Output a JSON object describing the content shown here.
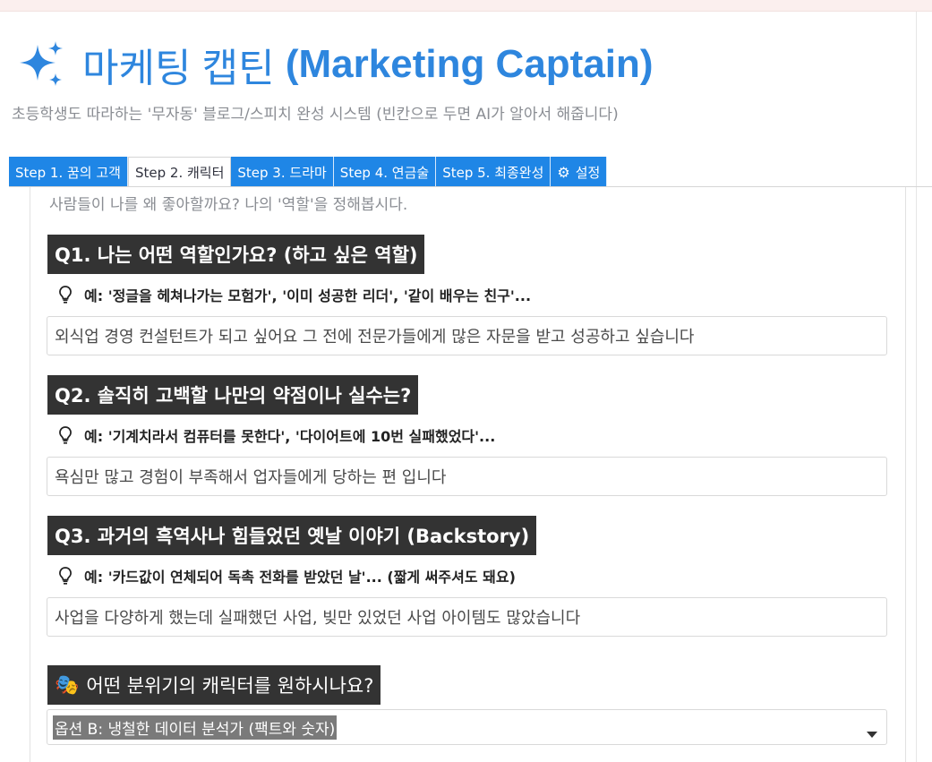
{
  "app": {
    "title_icon": "sparkles-icon",
    "title_korean": "마케팅 캡틴",
    "title_english": "(Marketing Captain)",
    "subtitle": "초등학생도 따라하는 '무자동' 블로그/스피치 완성 시스템 (빈칸으로 두면 AI가 알아서 해줍니다)",
    "accent_color": "#2e86de"
  },
  "tabs": [
    {
      "label": "Step 1. 꿈의 고객",
      "active": false
    },
    {
      "label": "Step 2. 캐릭터",
      "active": true
    },
    {
      "label": "Step 3. 드라마",
      "active": false
    },
    {
      "label": "Step 4. 연금술",
      "active": false
    },
    {
      "label": "Step 5. 최종완성",
      "active": false
    },
    {
      "label": "설정",
      "icon": "gear-icon",
      "active": false
    }
  ],
  "main": {
    "intro": "사람들이 나를 왜 좋아할까요? 나의 '역할'을 정해봅시다.",
    "questions": [
      {
        "heading": "Q1. 나는 어떤 역할인가요? (하고 싶은 역할)",
        "hint": "예: '정글을 헤쳐나가는 모험가', '이미 성공한 리더', '같이 배우는 친구'...",
        "answer": "외식업 경영 컨설턴트가 되고 싶어요   그 전에  전문가들에게  많은 자문을 받고 성공하고 싶습니다"
      },
      {
        "heading": "Q2. 솔직히 고백할 나만의 약점이나 실수는?",
        "hint": "예: '기계치라서 컴퓨터를 못한다', '다이어트에 10번 실패했었다'...",
        "answer": "욕심만  많고 경험이 부족해서  업자들에게 당하는 편 입니다"
      },
      {
        "heading": "Q3. 과거의 흑역사나 힘들었던 옛날 이야기 (Backstory)",
        "hint": "예: '카드값이 연체되어 독촉 전화를 받았던 날'... (짧게 써주셔도 돼요)",
        "answer": "사업을 다양하게 했는데  실패했던 사업, 빚만 있었던 사업 아이템도 많았습니다"
      }
    ],
    "mood": {
      "icon": "theater-masks-icon",
      "heading": "어떤 분위기의 캐릭터를 원하시나요?",
      "selected": "옵션 B: 냉철한 데이터 분석가 (팩트와 숫자)"
    }
  }
}
